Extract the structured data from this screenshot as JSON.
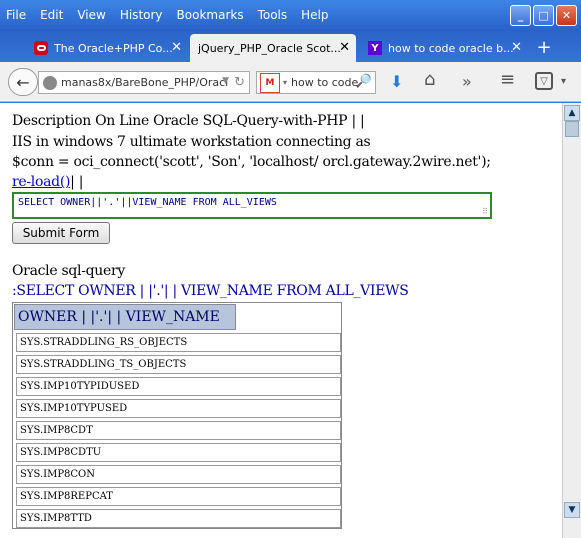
{
  "menu": [
    "File",
    "Edit",
    "View",
    "History",
    "Bookmarks",
    "Tools",
    "Help"
  ],
  "window_controls": {
    "minimize": "_",
    "maximize": "□",
    "close": "✕"
  },
  "tabs": [
    {
      "label": "The Oracle+PHP Co...",
      "icon": "oracle-icon",
      "close": "✕"
    },
    {
      "label": "jQuery_PHP_Oracle Scot...",
      "close": "✕"
    },
    {
      "label": "how to code oracle b...",
      "icon": "yahoo-icon",
      "icon_glyph": "Y",
      "close": "✕"
    }
  ],
  "new_tab": "+",
  "nav": {
    "back": "←",
    "url": "manas8x/BareBone_PHP/Oracl",
    "url_dropdown": "▼",
    "reload": "↻",
    "search_text": "how to code",
    "search_engine_glyph": "M",
    "search_engine_dropdown": "▾",
    "search_icon": "🔎",
    "download": "⬇",
    "home": "⌂",
    "overflow": "»",
    "menu": "≡",
    "pocket": "▽",
    "pocket_dropdown": "▾"
  },
  "page": {
    "line1": "Description On Line Oracle SQL-Query-with-PHP | |",
    "line2": "IIS in windows 7 ultimate workstation connecting as",
    "line3": "$conn = oci_connect('scott', 'Son', 'localhost/ orcl.gateway.2wire.net');",
    "reload_link": "re-load()",
    "reload_suffix": "| |",
    "query_value": "SELECT OWNER||'.'||VIEW_NAME FROM ALL_VIEWS",
    "query_grip": "⠿",
    "submit_label": "Submit Form",
    "result_title": "Oracle sql-query",
    "result_query": ":SELECT OWNER | |'.'| | VIEW_NAME FROM ALL_VIEWS",
    "table_header": "OWNER | |'.'| | VIEW_NAME",
    "rows": [
      "SYS.STRADDLING_RS_OBJECTS",
      "SYS.STRADDLING_TS_OBJECTS",
      "SYS.IMP10TYPIDUSED",
      "SYS.IMP10TYPUSED",
      "SYS.IMP8CDT",
      "SYS.IMP8CDTU",
      "SYS.IMP8CON",
      "SYS.IMP8REPCAT",
      "SYS.IMP8TTD"
    ]
  },
  "scrollbar": {
    "up": "▲",
    "down": "▼"
  }
}
